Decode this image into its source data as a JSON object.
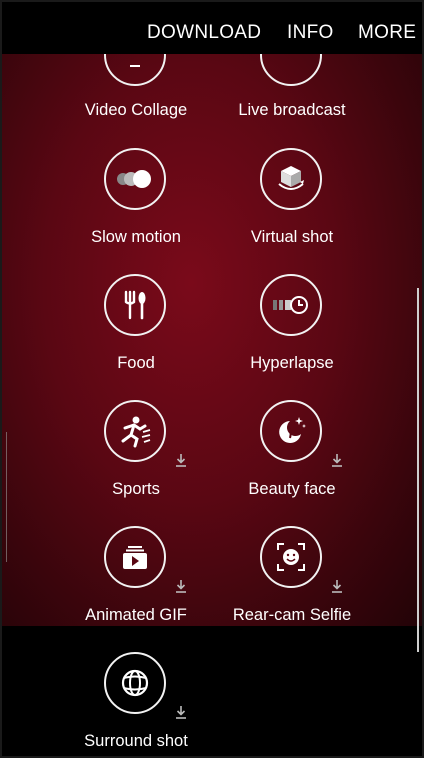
{
  "top_bar": {
    "download_label": "DOWNLOAD",
    "info_label": "INFO",
    "more_label": "MORE"
  },
  "modes": {
    "video_collage": "Video Collage",
    "live_broadcast": "Live broadcast",
    "slow_motion": "Slow motion",
    "virtual_shot": "Virtual shot",
    "food": "Food",
    "hyperlapse": "Hyperlapse",
    "sports": "Sports",
    "beauty_face": "Beauty face",
    "animated_gif": "Animated GIF",
    "rear_cam_selfie": "Rear-cam Selfie",
    "surround_shot": "Surround shot"
  },
  "icons": {
    "download": "download-icon",
    "slow_motion": "slow-motion-icon",
    "virtual_shot": "virtual-shot-icon",
    "food": "food-icon",
    "hyperlapse": "hyperlapse-icon",
    "sports": "sports-icon",
    "beauty_face": "beauty-face-icon",
    "animated_gif": "animated-gif-icon",
    "rear_cam_selfie": "rear-cam-selfie-icon",
    "surround_shot": "surround-shot-icon"
  },
  "colors": {
    "background_center": "#7a0a1a",
    "background_edge": "#220307",
    "top_bar": "#000000",
    "foreground": "#ffffff"
  }
}
